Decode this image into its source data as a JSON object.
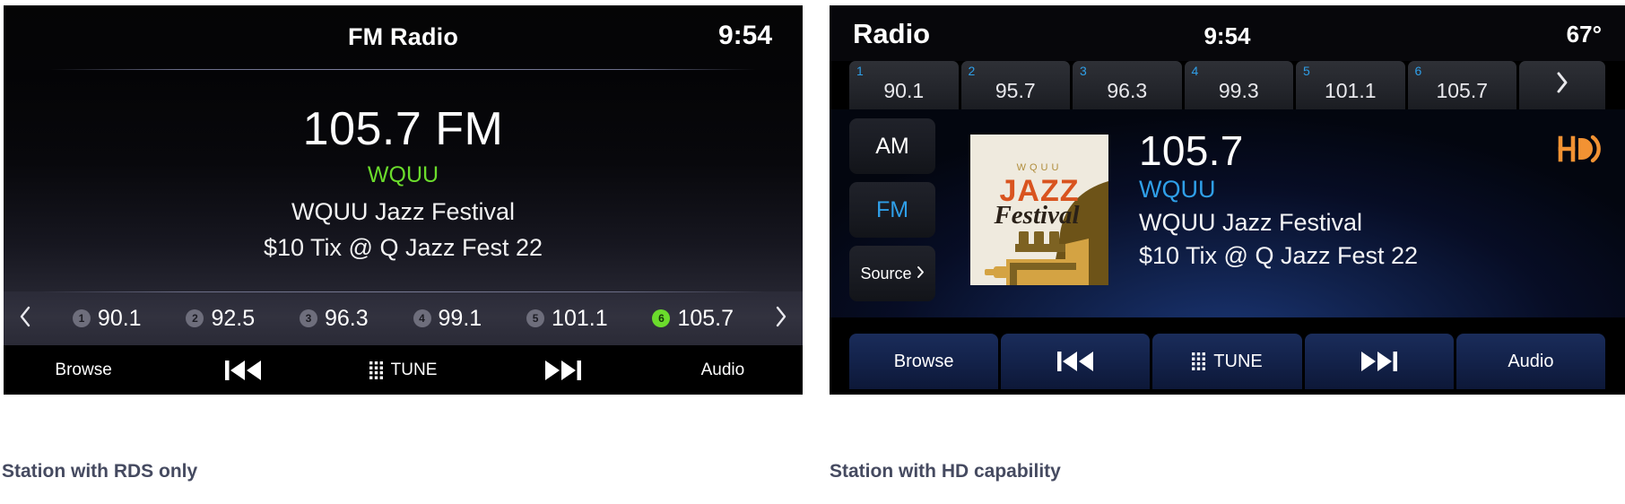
{
  "captions": {
    "left": "Station with RDS only",
    "right": "Station with HD capability"
  },
  "colors": {
    "rds_green": "#6bdc2c",
    "hd_blue": "#2f9fe8",
    "hd_orange": "#f29233",
    "panel_black": "#000000",
    "caption_gray": "#454a60"
  },
  "rds_panel": {
    "header": {
      "title": "FM Radio",
      "clock": "9:54"
    },
    "now_playing": {
      "frequency": "105.7 FM",
      "call_sign": "WQUU",
      "line1": "WQUU Jazz Festival",
      "line2": "$10 Tix @ Q Jazz Fest 22"
    },
    "presets": {
      "prev_icon": "chevron-left-icon",
      "next_icon": "chevron-right-icon",
      "items": [
        {
          "num": "1",
          "value": "90.1",
          "active": false
        },
        {
          "num": "2",
          "value": "92.5",
          "active": false
        },
        {
          "num": "3",
          "value": "96.3",
          "active": false
        },
        {
          "num": "4",
          "value": "99.1",
          "active": false
        },
        {
          "num": "5",
          "value": "101.1",
          "active": false
        },
        {
          "num": "6",
          "value": "105.7",
          "active": true
        }
      ]
    },
    "toolbar": {
      "browse": "Browse",
      "prev_track": "previous-track-icon",
      "tune": "TUNE",
      "tune_icon": "keypad-grid-icon",
      "next_track": "next-track-icon",
      "audio": "Audio"
    }
  },
  "hd_panel": {
    "header": {
      "title": "Radio",
      "clock": "9:54",
      "temperature": "67°"
    },
    "presets": {
      "items": [
        {
          "num": "1",
          "value": "90.1"
        },
        {
          "num": "2",
          "value": "95.7"
        },
        {
          "num": "3",
          "value": "96.3"
        },
        {
          "num": "4",
          "value": "99.3"
        },
        {
          "num": "5",
          "value": "101.1"
        },
        {
          "num": "6",
          "value": "105.7"
        }
      ],
      "next_label": "›",
      "next_icon": "chevron-right-icon"
    },
    "side_buttons": {
      "am": "AM",
      "fm": "FM",
      "source": "Source",
      "source_chevron": "›",
      "source_icon": "chevron-right-icon"
    },
    "album_art": {
      "alt": "album-art-wquu-jazz-festival",
      "text_top": "W Q U U",
      "text_jazz": "JAZZ",
      "text_festival": "Festival"
    },
    "now_playing": {
      "frequency": "105.7",
      "call_sign": "WQUU",
      "line1": "WQUU Jazz Festival",
      "line2": "$10 Tix @ Q Jazz Fest 22"
    },
    "hd_logo": {
      "label": "HD",
      "icon": "hd-radio-icon"
    },
    "toolbar": {
      "browse": "Browse",
      "prev_track": "previous-track-icon",
      "tune": "TUNE",
      "tune_icon": "keypad-grid-icon",
      "next_track": "next-track-icon",
      "audio": "Audio"
    }
  }
}
